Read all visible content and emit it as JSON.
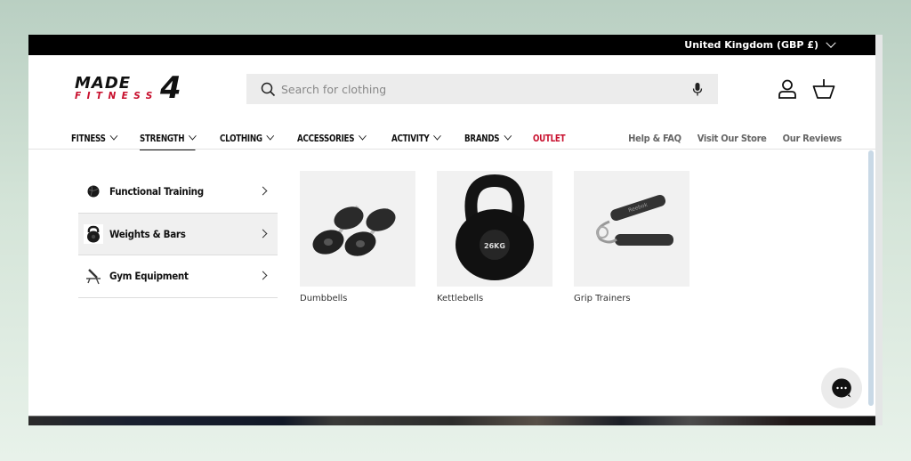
{
  "announcement": {
    "region_selector": "United Kingdom (GBP £)"
  },
  "brand": {
    "logo_top": "MADE",
    "logo_bottom": "FITNESS",
    "logo_number": "4",
    "accent_color": "#c8102e"
  },
  "search": {
    "placeholder": "Search for clothing",
    "value": ""
  },
  "header_icons": [
    "account-icon",
    "basket-icon"
  ],
  "nav": {
    "items": [
      {
        "label": "FITNESS",
        "has_dropdown": true
      },
      {
        "label": "STRENGTH",
        "has_dropdown": true,
        "active": true
      },
      {
        "label": "CLOTHING",
        "has_dropdown": true
      },
      {
        "label": "ACCESSORIES",
        "has_dropdown": true
      },
      {
        "label": "ACTIVITY",
        "has_dropdown": true
      },
      {
        "label": "BRANDS",
        "has_dropdown": true
      },
      {
        "label": "OUTLET",
        "has_dropdown": false
      }
    ],
    "secondary": [
      {
        "label": "Help & FAQ"
      },
      {
        "label": "Visit Our Store"
      },
      {
        "label": "Our Reviews"
      }
    ]
  },
  "mega_menu": {
    "categories": [
      {
        "label": "Functional Training",
        "icon": "medicine-ball-icon"
      },
      {
        "label": "Weights & Bars",
        "icon": "kettlebell-icon",
        "active": true
      },
      {
        "label": "Gym Equipment",
        "icon": "bench-icon"
      }
    ],
    "products": [
      {
        "label": "Dumbbells",
        "image": "dumbbells-image"
      },
      {
        "label": "Kettlebells",
        "image": "kettlebell-image",
        "image_text": "26KG"
      },
      {
        "label": "Grip Trainers",
        "image": "grip-trainer-image",
        "image_text": "Reebok"
      }
    ]
  },
  "chat": {
    "icon": "chat-bubble-icon"
  }
}
